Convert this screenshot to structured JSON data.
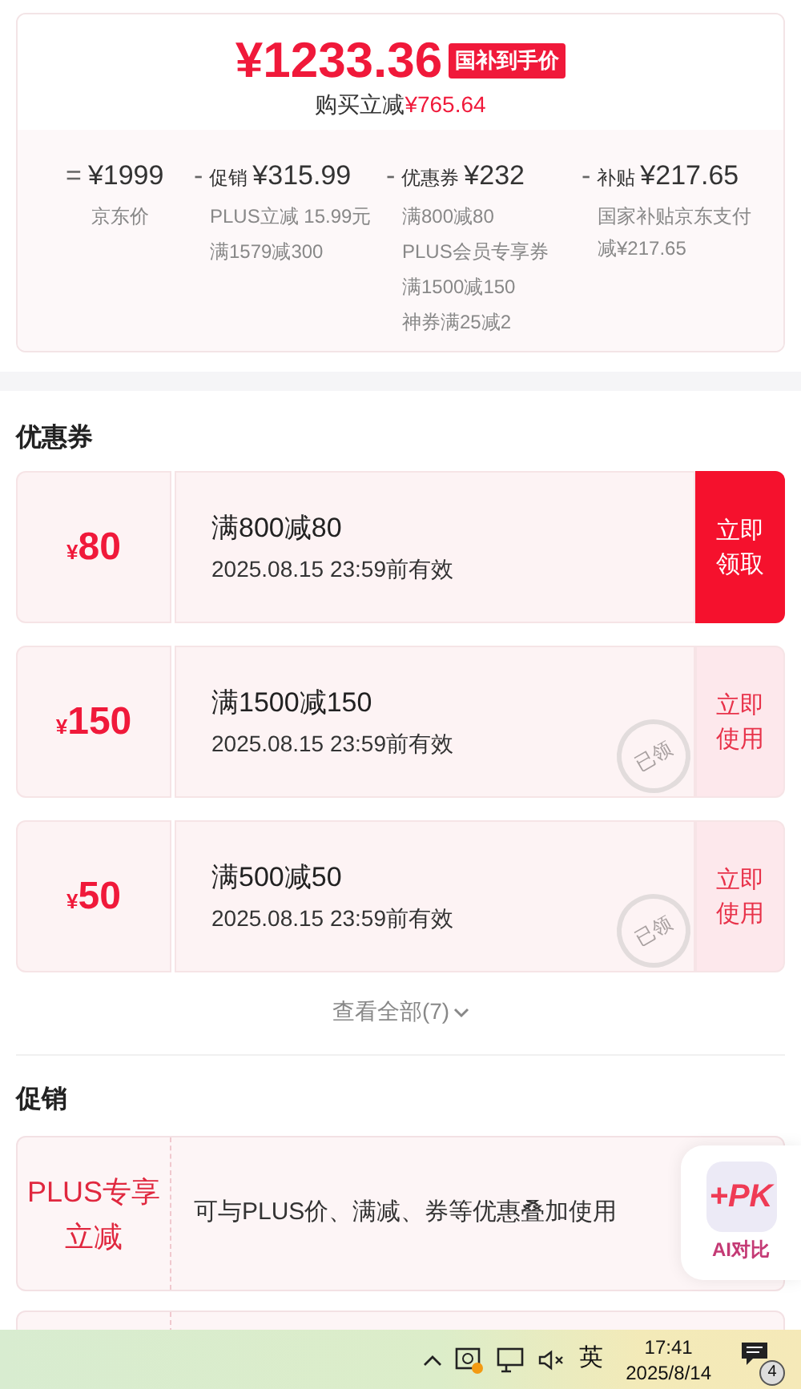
{
  "price": {
    "amount": "¥1233.36",
    "badge": "国补到手价",
    "saving_label": "购买立减",
    "saving_amount": "¥765.64"
  },
  "breakdown": [
    {
      "operator": "=",
      "amount": "¥1999",
      "lines": [
        "京东价"
      ]
    },
    {
      "operator": "-",
      "label": "促销",
      "amount": "¥315.99",
      "lines": [
        "PLUS立减 15.99元",
        "满1579减300"
      ]
    },
    {
      "operator": "-",
      "label": "优惠券",
      "amount": "¥232",
      "lines": [
        "满800减80",
        "PLUS会员专享券",
        "满1500减150",
        "神券满25减2"
      ]
    },
    {
      "operator": "-",
      "label": "补贴",
      "amount": "¥217.65",
      "lines": [
        "国家补贴京东支付减¥217.65"
      ]
    }
  ],
  "coupons_section": {
    "title": "优惠券",
    "coupons": [
      {
        "value": "80",
        "title": "满800减80",
        "validity": "2025.08.15 23:59前有效",
        "action": "立即领取",
        "claimed": false
      },
      {
        "value": "150",
        "title": "满1500减150",
        "validity": "2025.08.15 23:59前有效",
        "action": "立即使用",
        "claimed": true,
        "stamp": "已领"
      },
      {
        "value": "50",
        "title": "满500减50",
        "validity": "2025.08.15 23:59前有效",
        "action": "立即使用",
        "claimed": true,
        "stamp": "已领"
      }
    ],
    "view_all": "查看全部(7)"
  },
  "currency_symbol": "¥",
  "promotions_section": {
    "title": "促销",
    "items": [
      {
        "label": "PLUS专享立减",
        "description": "可与PLUS价、满减、券等优惠叠加使用"
      }
    ]
  },
  "float_button": {
    "icon_text": "+PK",
    "label": "AI对比"
  },
  "taskbar": {
    "ime": "英",
    "time": "17:41",
    "date": "2025/8/14",
    "notifications": "4"
  }
}
